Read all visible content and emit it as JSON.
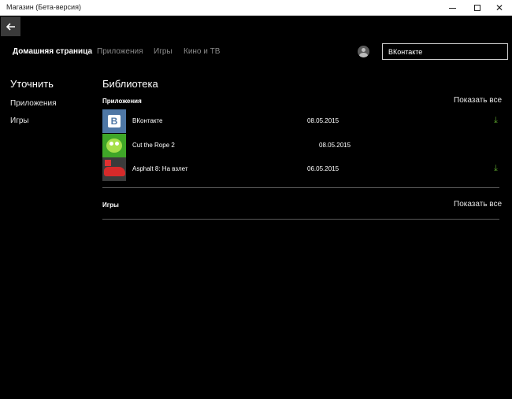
{
  "window": {
    "title": "Магазин (Бета-версия)",
    "minimize_glyph": "minimize-icon",
    "maximize_glyph": "maximize-icon",
    "close_glyph": "✕"
  },
  "back_button": {
    "icon": "arrow-left-icon",
    "glyph": "🡐"
  },
  "nav": {
    "items": [
      {
        "label": "Домашняя страница",
        "active": true
      },
      {
        "label": "Приложения",
        "active": false
      },
      {
        "label": "Игры",
        "active": false
      },
      {
        "label": "Кино и ТВ",
        "active": false
      }
    ]
  },
  "user": {
    "icon": "avatar-icon"
  },
  "search": {
    "value": "ВКонтакте"
  },
  "sidebar": {
    "title": "Уточнить",
    "items": [
      {
        "label": "Приложения"
      },
      {
        "label": "Игры"
      }
    ]
  },
  "library": {
    "title": "Библиотека",
    "sections": [
      {
        "label": "Приложения",
        "show_all": "Показать все",
        "items": [
          {
            "name": "ВКонтакте",
            "date": "08.05.2015",
            "download": true,
            "icon": "vk-app-icon",
            "thumb_letter": "B"
          },
          {
            "name": "Cut the Rope 2",
            "date": "08.05.2015",
            "download": false,
            "icon": "cut-the-rope-app-icon"
          },
          {
            "name": "Asphalt 8: На взлет",
            "date": "06.05.2015",
            "download": true,
            "icon": "asphalt-app-icon"
          }
        ]
      },
      {
        "label": "Игры",
        "show_all": "Показать все",
        "items": []
      }
    ]
  },
  "colors": {
    "background": "#000000",
    "titlebar": "#ffffff",
    "nav_inactive": "#8a8a8a",
    "download_accent": "#5aa02c",
    "vk_blue": "#4e77a5"
  },
  "download_glyph": "⤓"
}
